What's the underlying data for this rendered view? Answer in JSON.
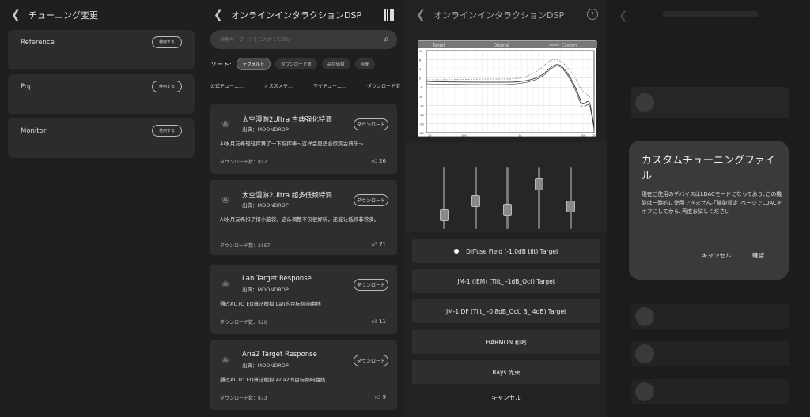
{
  "p1": {
    "title": "チューニング変更",
    "cards": [
      {
        "name": "Reference",
        "button": "使用する"
      },
      {
        "name": "Pop",
        "button": "使用する"
      },
      {
        "name": "Monitor",
        "button": "使用する"
      }
    ]
  },
  "p2": {
    "title": "オンラインインタラクションDSP",
    "search_placeholder": "検索キーワードをご入力ください",
    "sort_label": "ソート:",
    "sort_options": [
      "デフォルト",
      "ダウンロード数",
      "高評価数",
      "時間"
    ],
    "tabs": [
      "公式チューニ…",
      "オススメチ…",
      "マイチューニ…",
      "ダウンロード済"
    ],
    "cards": [
      {
        "title": "太空漫游2Ultra 古典强化特调",
        "source": "出典：MOONDROP",
        "desc": "Ai水月友希轻轻挥舞了一下指挥棒～这样会更适合欣赏古典乐～",
        "downloads": "ダウンロード数：817",
        "likes": "26",
        "button": "ダウンロード"
      },
      {
        "title": "太空漫游2Ultra 超多低频特调",
        "source": "出典：MOONDROP",
        "desc": "Ai水月友希扣了扣小脑袋，这么调整不仅很好听，还能让低频非常多。",
        "downloads": "ダウンロード数：2157",
        "likes": "71",
        "button": "ダウンロード"
      },
      {
        "title": "Lan Target Response",
        "source": "出典：MOONDROP",
        "desc": "通过AUTO EQ算法模拟 Lan的目标频响曲线",
        "downloads": "ダウンロード数：520",
        "likes": "11",
        "button": "ダウンロード"
      },
      {
        "title": "Aria2 Target Response",
        "source": "出典：MOONDROP",
        "desc": "通过AUTO EQ算法模拟 Aria2的目标频响曲线",
        "downloads": "ダウンロード数：873",
        "likes": "9",
        "button": "ダウンロード"
      }
    ]
  },
  "p3": {
    "title": "オンラインインタラクションDSP",
    "legend": [
      "Target",
      "Original",
      "Custom"
    ],
    "y_ticks": [
      "12",
      "8",
      "4",
      "0",
      "-4",
      "-8",
      "-12",
      "-16",
      "-20",
      "-24"
    ],
    "x_ticks": [
      "20",
      "100",
      "1k",
      "10k",
      "20k"
    ],
    "slider_levels": [
      0.25,
      0.5,
      0.35,
      0.8,
      0.4
    ],
    "options": [
      "Diffuse Field (-1.0dB tilt) Target",
      "JM-1 (IEM) (Tilt_ -1dB_Oct) Target",
      "JM-1 DF (Tilt_ -0.8dB_Oct, B_ 4dB) Target",
      "HARMON 和鸣",
      "Rays 光束"
    ],
    "selected_index": 0,
    "cancel": "キャンセル"
  },
  "p4": {
    "dialog_title": "カスタムチューニングファイル",
    "dialog_message": "現在ご使用のデバイスはLDACモードになっており､この機能は一時的に使用できません｡｢機能設定｣ページでLDACをオフにしてから､再度お試しください",
    "cancel": "キャンセル",
    "confirm": "確認"
  }
}
